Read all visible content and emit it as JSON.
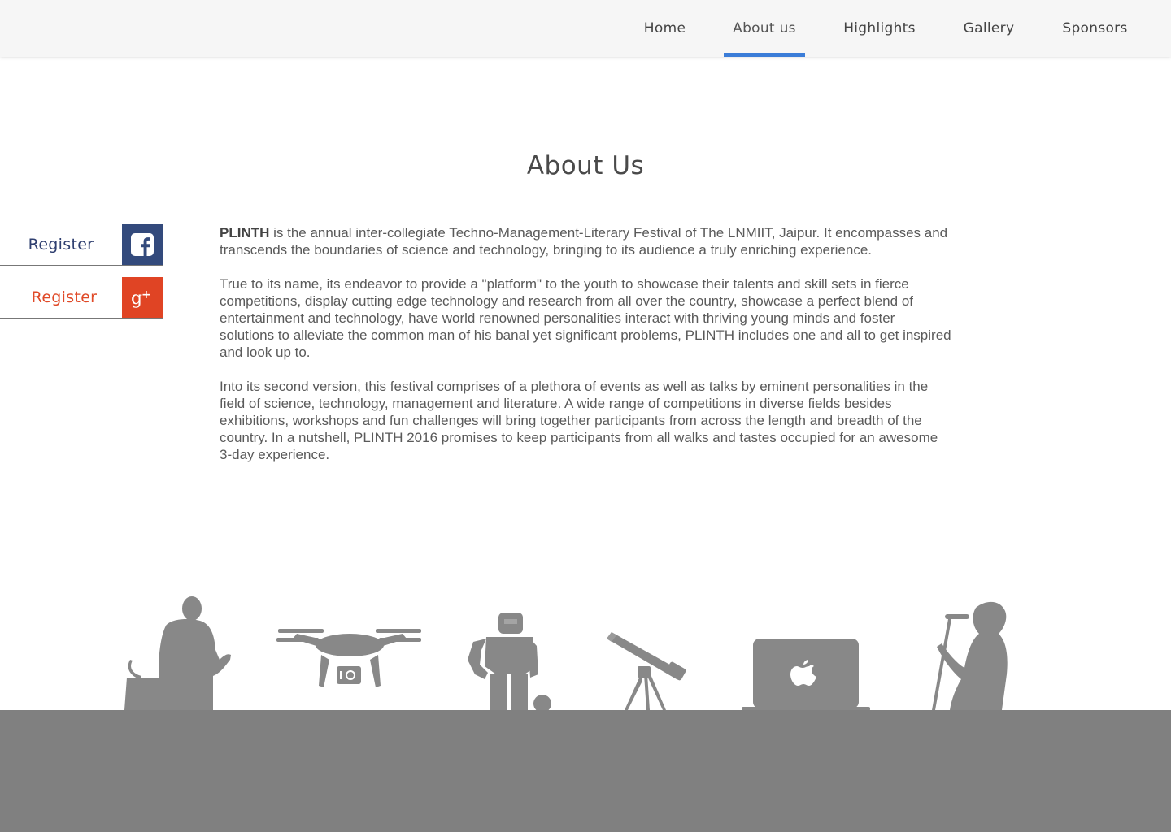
{
  "nav": {
    "items": [
      {
        "label": "Home"
      },
      {
        "label": "About us"
      },
      {
        "label": "Highlights"
      },
      {
        "label": "Gallery"
      },
      {
        "label": "Sponsors"
      }
    ],
    "active_index": 1,
    "active_color": "#3b7dd8"
  },
  "page": {
    "title": "About Us"
  },
  "register": {
    "facebook": {
      "label": "Register",
      "icon": "facebook-icon",
      "color": "#334a7c"
    },
    "google_plus": {
      "label": "Register",
      "icon": "google-plus-icon",
      "color": "#e04424"
    }
  },
  "about": {
    "brand": "PLINTH",
    "p1_rest": " is the annual inter-collegiate Techno-Management-Literary Festival of The LNMIIT, Jaipur. It encompasses and transcends the boundaries of science and technology, bringing to its audience a truly enriching experience.",
    "p2": "True to its name, its endeavor to provide a \"platform\" to the youth to showcase their talents and skill sets in fierce competitions, display cutting edge technology and research from all over the country, showcase a perfect blend of entertainment and technology, have world renowned personalities interact with thriving young minds and foster solutions to alleviate the common man of his banal yet significant problems, PLINTH includes one and all to get inspired and look up to.",
    "p3": "Into its second version, this festival comprises of a plethora of events as well as talks by eminent personalities in the field of science, technology, management and literature. A wide range of competitions in diverse fields besides exhibitions, workshops and fun challenges will bring together participants from across the length and breadth of the country. In a nutshell, PLINTH 2016 promises to keep participants from all walks and tastes occupied for an awesome 3-day experience."
  },
  "footer": {
    "silhouettes": [
      "speaker-at-podium-icon",
      "drone-icon",
      "robot-icon",
      "telescope-icon",
      "laptop-apple-icon",
      "singer-with-mic-icon"
    ],
    "band_color": "#808080"
  }
}
